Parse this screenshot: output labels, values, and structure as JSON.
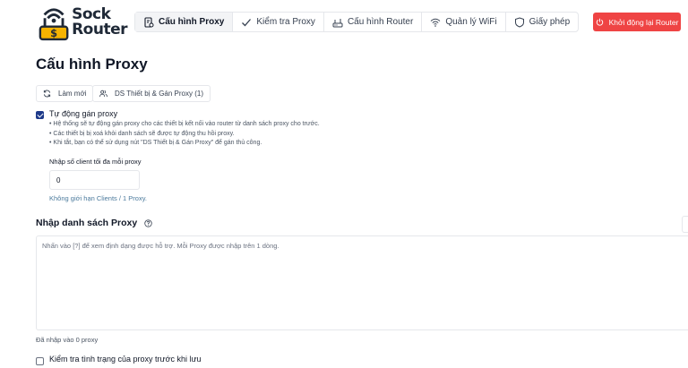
{
  "logo": {
    "line1": "Sock",
    "line2": "Router"
  },
  "nav": {
    "tabs": [
      {
        "label": "Cấu hình Proxy",
        "icon": "proxy-config-icon",
        "active": true
      },
      {
        "label": "Kiểm tra Proxy",
        "icon": "check-icon",
        "active": false
      },
      {
        "label": "Cấu hình Router",
        "icon": "router-icon",
        "active": false
      },
      {
        "label": "Quản lý WiFi",
        "icon": "wifi-icon",
        "active": false
      },
      {
        "label": "Giấy phép",
        "icon": "shield-icon",
        "active": false
      }
    ]
  },
  "header": {
    "restart_label": "Khởi động lại Router"
  },
  "page": {
    "title": "Cấu hình Proxy"
  },
  "toolbar": {
    "refresh_label": "Làm mới",
    "devices_label": "DS Thiết bị & Gán Proxy (1)"
  },
  "auto_assign": {
    "checked": true,
    "label": "Tự động gán proxy",
    "notes": [
      "• Hệ thống sẽ tự động gán proxy cho các thiết bị kết nối vào router từ danh sách proxy cho trước.",
      "• Các thiết bị bị xoá khỏi danh sách sẽ được tự động thu hồi proxy.",
      "• Khi tắt, bạn có thể sử dụng nút \"DS Thiết bị & Gán Proxy\" để gán thủ công."
    ],
    "max_clients_label": "Nhập số client tối đa mỗi proxy",
    "max_clients_value": "0",
    "max_clients_hint": "Không giới hạn Clients / 1 Proxy."
  },
  "proxy_list": {
    "title": "Nhập danh sách Proxy",
    "placeholder": "Nhấn vào [?] để xem định dạng được hỗ trợ. Mỗi Proxy được nhập trên 1 dòng.",
    "count_text": "Đã nhập vào 0 proxy"
  },
  "health_check": {
    "checked": false,
    "label": "Kiểm tra tình trạng của proxy trước khi lưu"
  },
  "colors": {
    "accent": "#1e3a8a",
    "danger": "#ef4444",
    "border": "#e5e7eb",
    "hint": "#4b7a9c"
  }
}
